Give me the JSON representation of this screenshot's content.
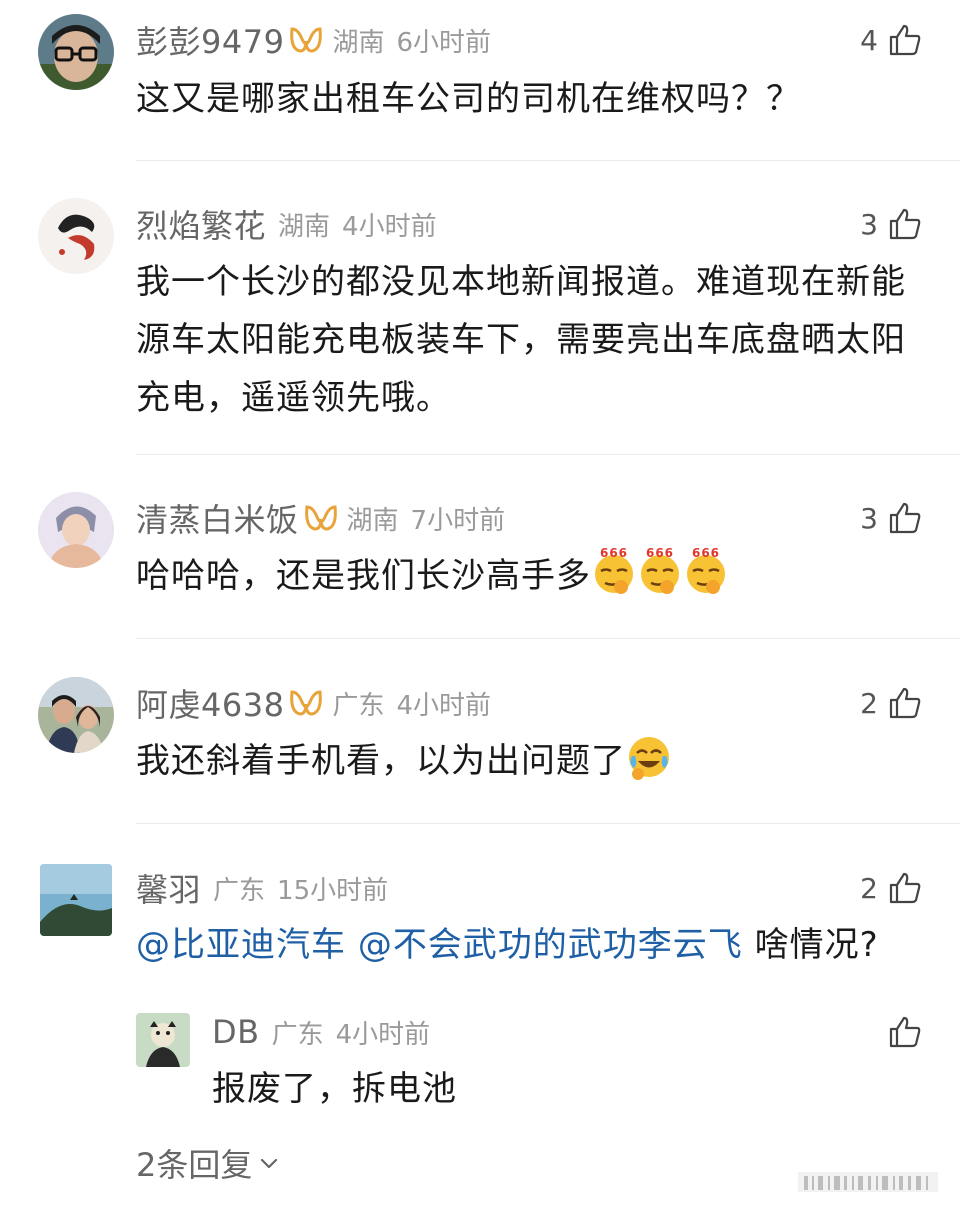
{
  "comments": [
    {
      "username": "彭彭9479",
      "vip": true,
      "location": "湖南",
      "time": "6小时前",
      "likes": "4",
      "text": "这又是哪家出租车公司的司机在维权吗？？"
    },
    {
      "username": "烈焰繁花",
      "vip": false,
      "location": "湖南",
      "time": "4小时前",
      "likes": "3",
      "text_lines": [
        "我一个长沙的都没见本地新闻报道。难道现在新能",
        "源车太阳能充电板装车下，需要亮出车底盘晒太阳",
        "充电，遥遥领先哦。"
      ]
    },
    {
      "username": "清蒸白米饭",
      "vip": true,
      "location": "湖南",
      "time": "7小时前",
      "likes": "3",
      "text": "哈哈哈，还是我们长沙高手多",
      "emoji_label": "666",
      "emoji_name": "666-emoji"
    },
    {
      "username": "阿虔4638",
      "vip": true,
      "location": "广东",
      "time": "4小时前",
      "likes": "2",
      "text": "我还斜着手机看，以为出问题了",
      "emoji_name": "crying-laughing-emoji"
    },
    {
      "username": "馨羽",
      "vip": false,
      "location": "广东",
      "time": "15小时前",
      "likes": "2",
      "mention_1": "@比亚迪汽车",
      "mention_2": "@不会武功的武功李云飞",
      "text": "啥情况?"
    }
  ],
  "reply": {
    "username": "DB",
    "location": "广东",
    "time": "4小时前",
    "text": "报废了，拆电池"
  },
  "reply_more": {
    "label": "2条回复"
  },
  "colors": {
    "mention": "#1f5fa6",
    "vip": "#e8a33a",
    "meta": "#9a9a9a"
  }
}
